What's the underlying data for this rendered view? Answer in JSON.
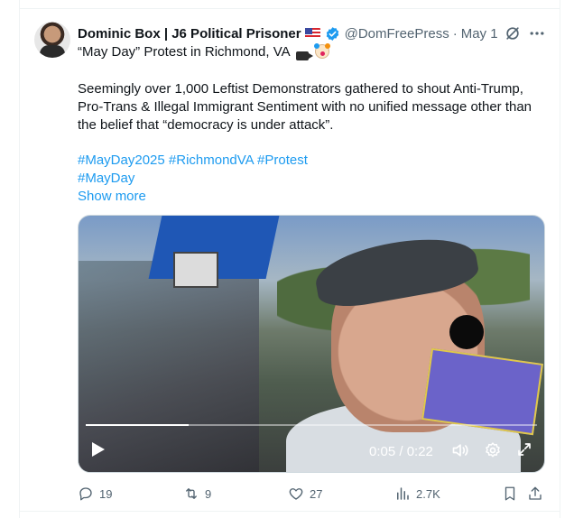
{
  "tweet": {
    "author_name": "Dominic Box | J6 Political Prisoner",
    "handle": "@DomFreePress",
    "separator": "·",
    "date": "May 1",
    "title_line": "“May Day” Protest in Richmond, VA",
    "body_lines": [
      "Seemingly over 1,000 Leftist Demonstrators gathered to shout Anti-Trump,",
      "Pro-Trans & Illegal Immigrant Sentiment with no unified message other than",
      "the belief that “democracy is under attack”."
    ],
    "hashtags_line1": [
      "#MayDay2025",
      "#RichmondVA",
      "#Protest"
    ],
    "hashtags_line2": [
      "#MayDay"
    ],
    "show_more": "Show more"
  },
  "video": {
    "time": "0:05 / 0:22",
    "progress": 0.227
  },
  "actions": {
    "replies": "19",
    "reposts": "9",
    "likes": "27",
    "views": "2.7K"
  },
  "colors": {
    "accent": "#1d9bf0",
    "muted": "#536471",
    "text": "#0f1419"
  },
  "icons": [
    "verified-badge-icon",
    "us-flag-icon",
    "grok-icon",
    "more-icon",
    "movie-camera-icon",
    "clown-face-icon",
    "play-icon",
    "volume-icon",
    "settings-gear-icon",
    "fullscreen-icon",
    "reply-icon",
    "repost-icon",
    "like-heart-icon",
    "views-chart-icon",
    "bookmark-icon",
    "share-icon"
  ]
}
